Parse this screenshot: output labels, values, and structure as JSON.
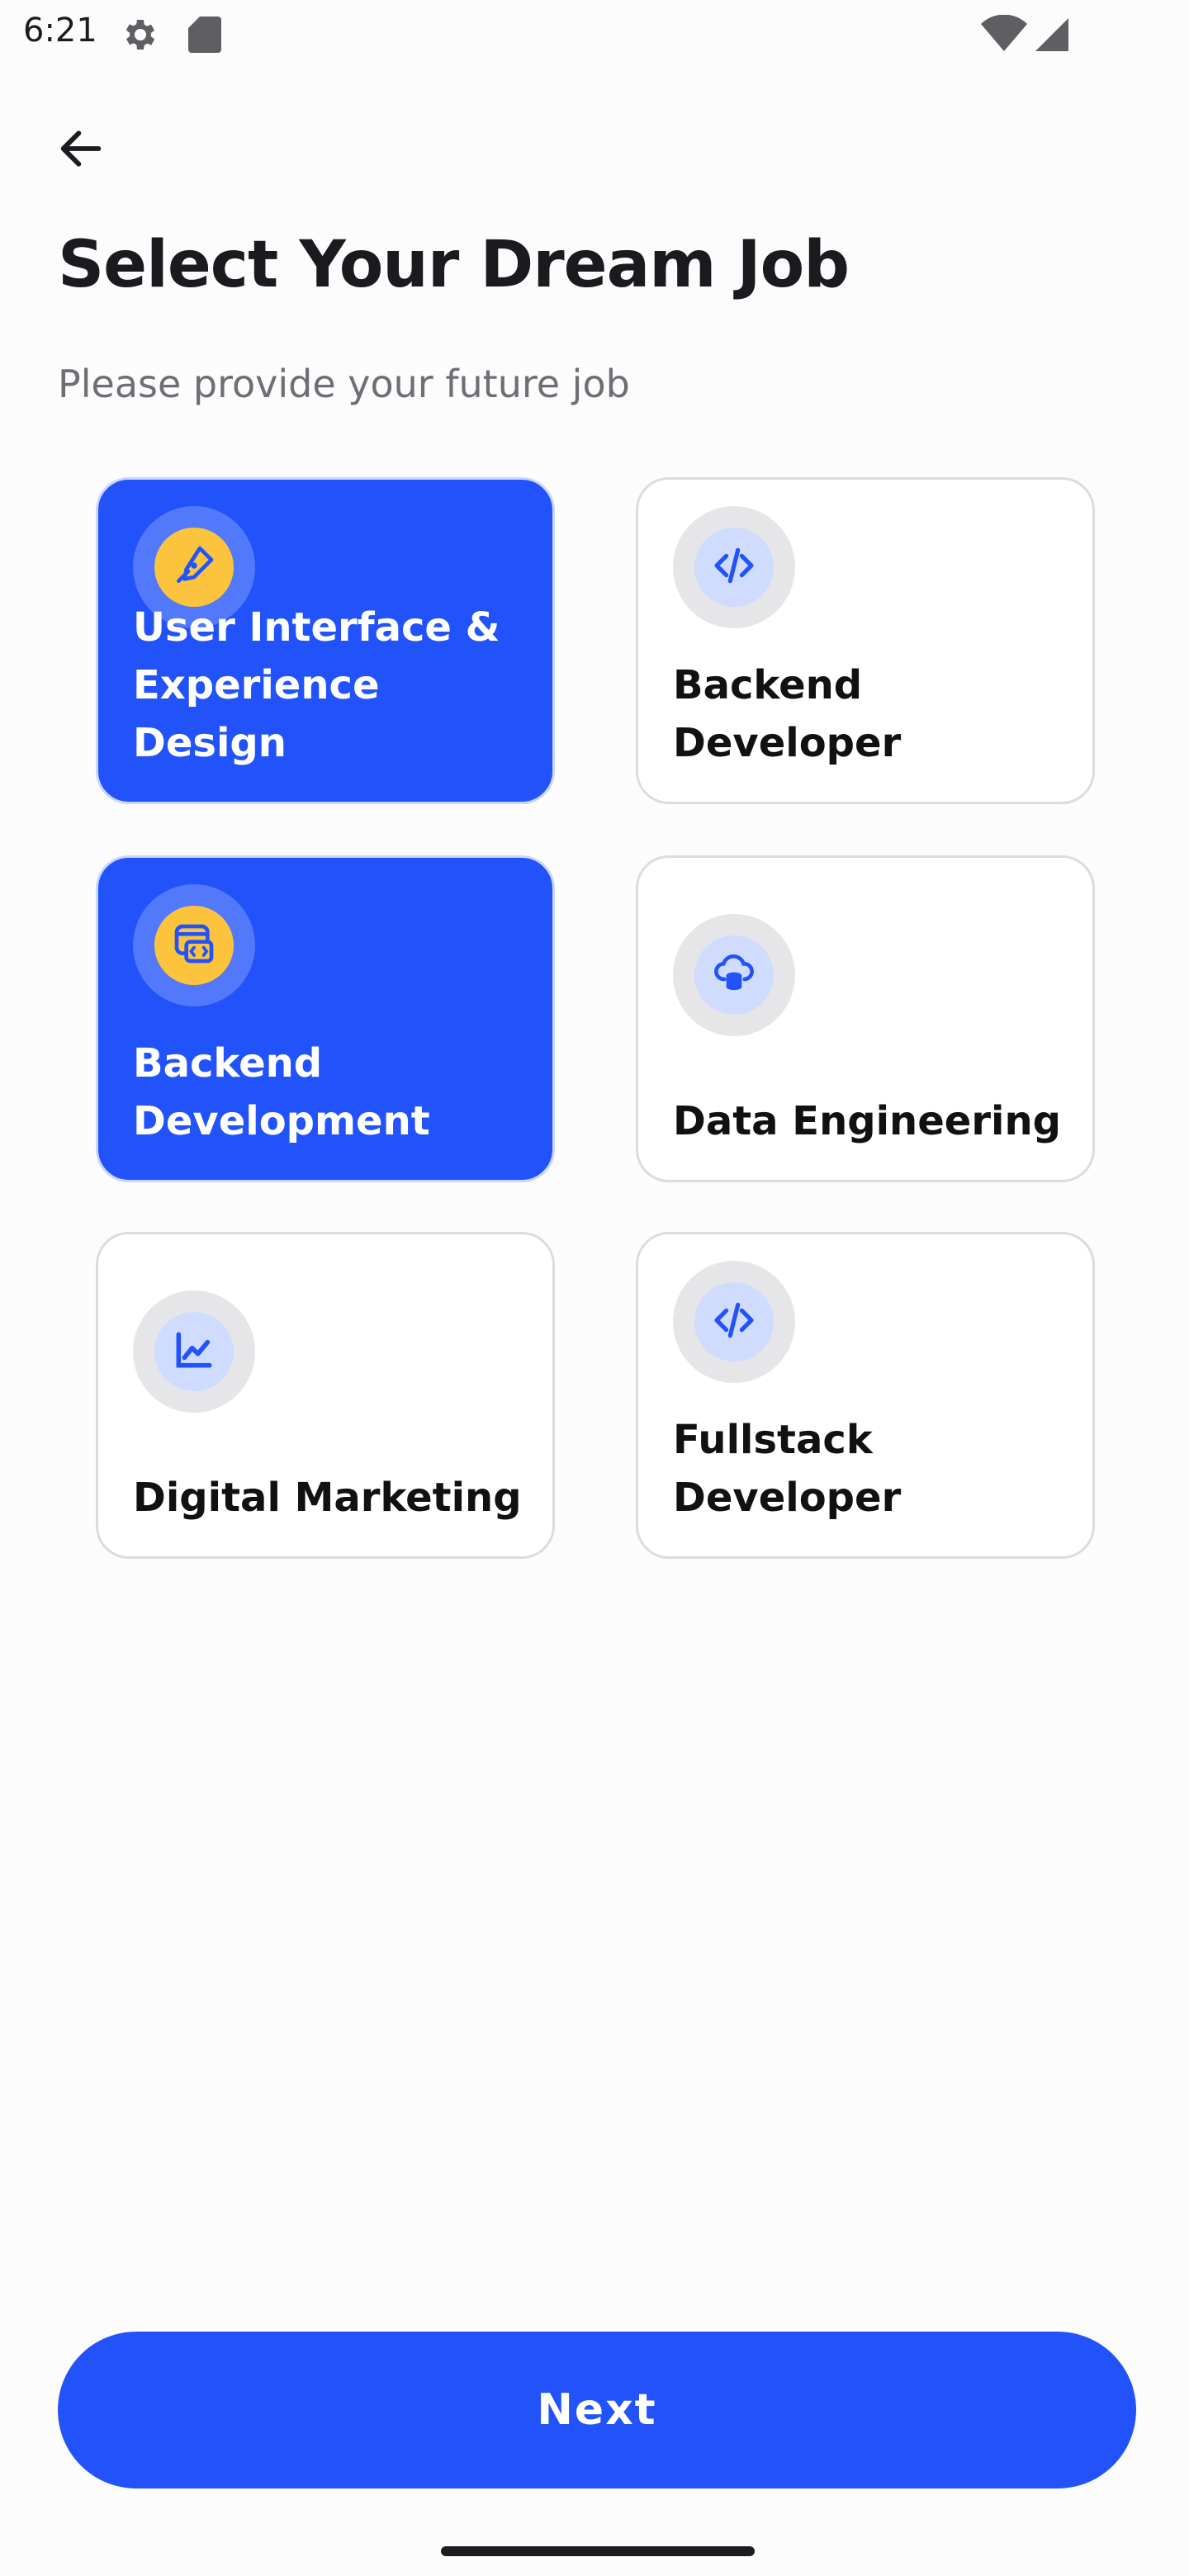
{
  "status_bar": {
    "time": "6:21",
    "icons": [
      "gear-icon",
      "sd-card-icon",
      "wifi-icon",
      "cellular-signal-icon"
    ]
  },
  "header": {
    "back_icon": "arrow-left-icon",
    "title": "Select Your Dream Job",
    "subtitle": "Please provide your future job"
  },
  "jobs": [
    {
      "label": "User Interface & Experience Design",
      "icon": "pen-nib-icon",
      "selected": true
    },
    {
      "label": "Backend Developer",
      "icon": "code-icon",
      "selected": false
    },
    {
      "label": "Backend Development",
      "icon": "code-window-icon",
      "selected": true
    },
    {
      "label": "Data Engineering",
      "icon": "cloud-database-icon",
      "selected": false
    },
    {
      "label": "Digital Marketing",
      "icon": "chart-line-icon",
      "selected": false
    },
    {
      "label": "Fullstack Developer",
      "icon": "code-icon",
      "selected": false
    }
  ],
  "footer": {
    "next_label": "Next"
  },
  "colors": {
    "accent": "#2253fa",
    "icon_highlight": "#fcc43c",
    "icon_blue": "#2253fa",
    "card_border": "#dcdcdf"
  }
}
